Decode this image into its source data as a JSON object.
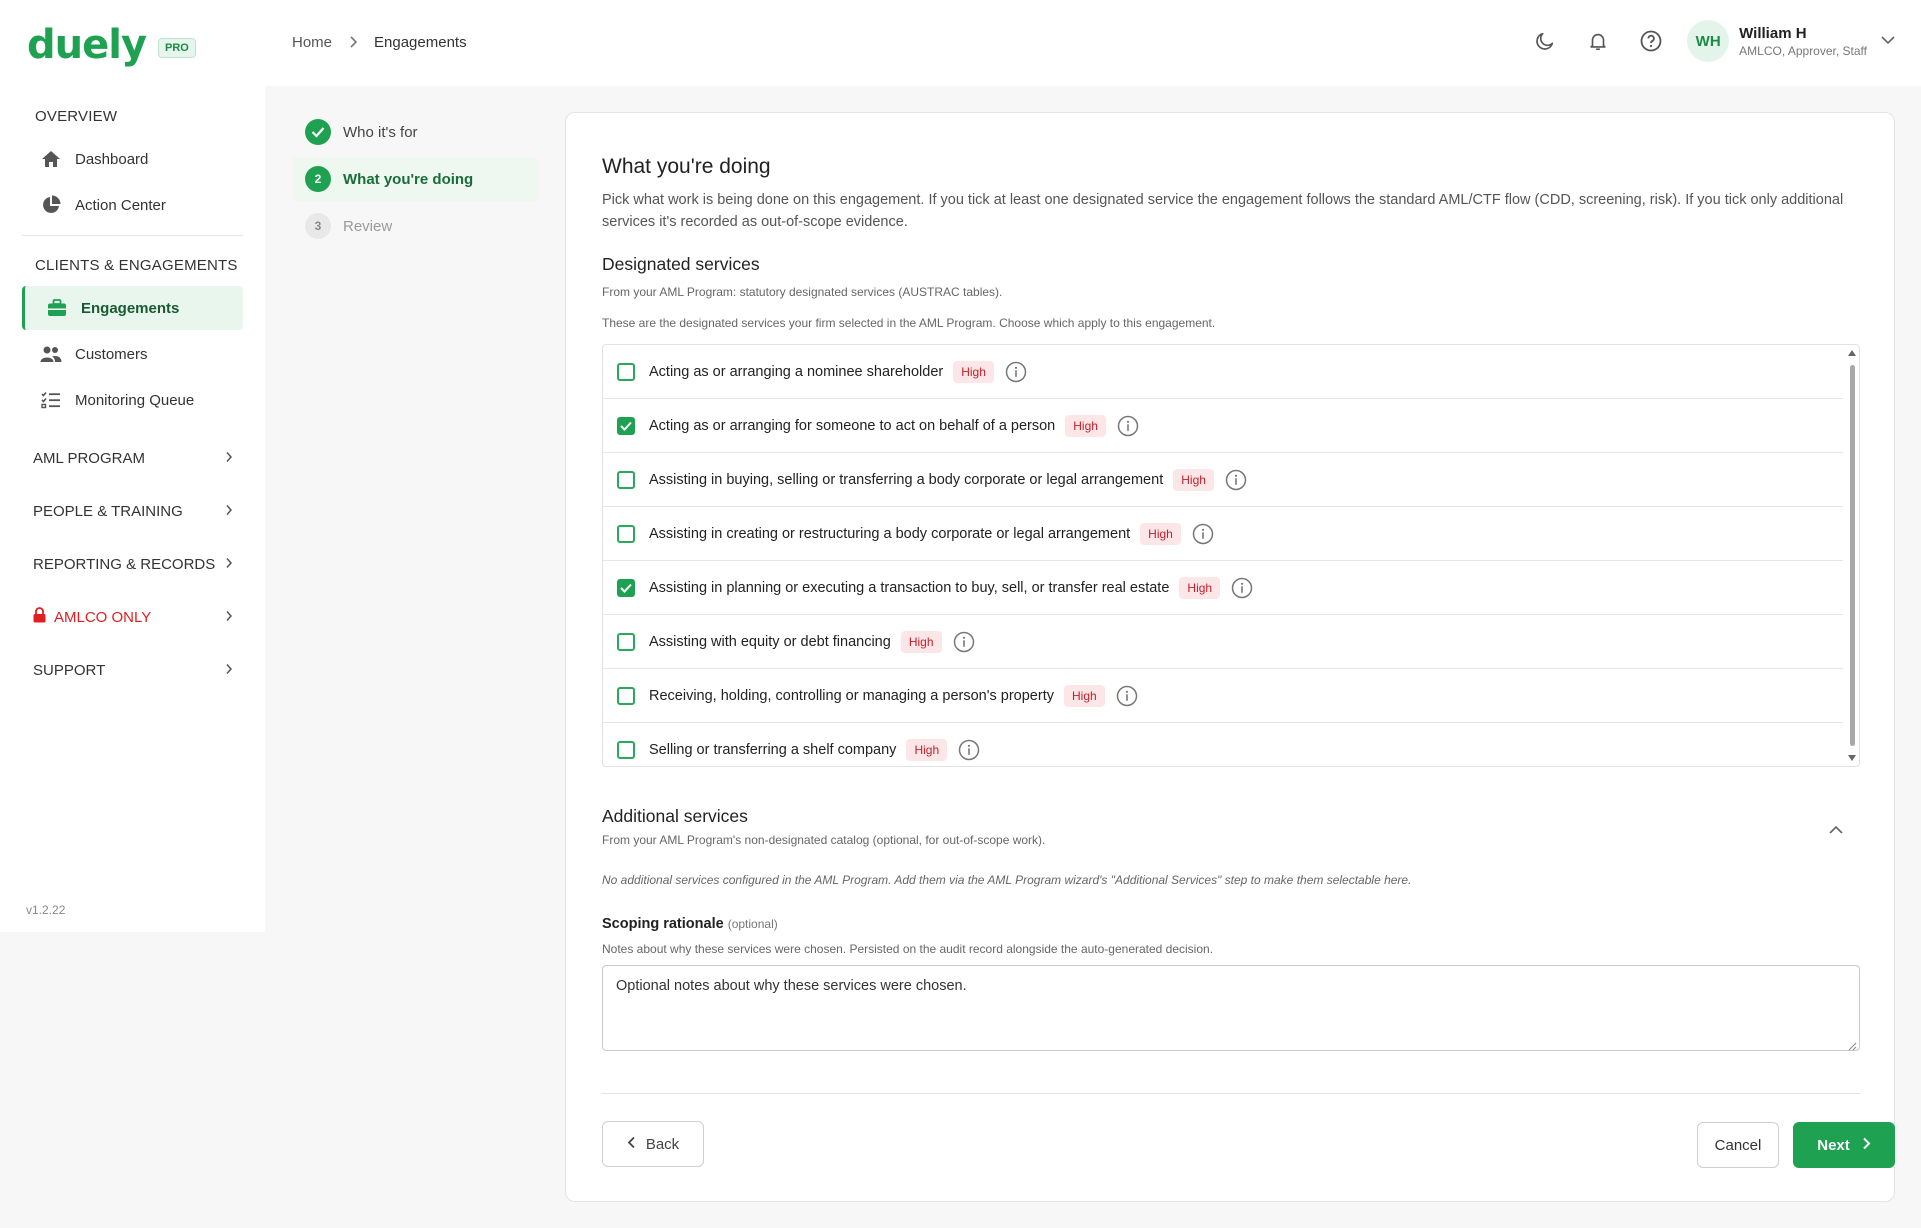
{
  "brand": {
    "name": "duely",
    "tier": "PRO"
  },
  "breadcrumb": {
    "home": "Home",
    "current": "Engagements"
  },
  "topbar": {
    "icons": [
      "moon-icon",
      "bell-icon",
      "help-icon"
    ],
    "user": {
      "initials": "WH",
      "name": "William H",
      "role": "AMLCO, Approver, Staff"
    }
  },
  "sidebar": {
    "overview_label": "OVERVIEW",
    "overview_items": [
      {
        "label": "Dashboard",
        "icon": "home-icon"
      },
      {
        "label": "Action Center",
        "icon": "pie-chart-icon"
      }
    ],
    "clients_label": "CLIENTS & ENGAGEMENTS",
    "clients_items": [
      {
        "label": "Engagements",
        "icon": "briefcase-icon",
        "active": true
      },
      {
        "label": "Customers",
        "icon": "people-icon"
      },
      {
        "label": "Monitoring Queue",
        "icon": "checklist-icon"
      }
    ],
    "groups": [
      {
        "label": "AML PROGRAM"
      },
      {
        "label": "PEOPLE & TRAINING"
      },
      {
        "label": "REPORTING & RECORDS"
      },
      {
        "label": "AMLCO ONLY",
        "color": "#e02020"
      },
      {
        "label": "SUPPORT"
      }
    ],
    "version": "v1.2.22"
  },
  "stepper": {
    "steps": [
      {
        "label": "Who it's for",
        "state": "done"
      },
      {
        "number": "2",
        "label": "What you're doing",
        "state": "active"
      },
      {
        "number": "3",
        "label": "Review",
        "state": "todo"
      }
    ]
  },
  "main": {
    "title": "What you're doing",
    "description": "Pick what work is being done on this engagement. If you tick at least one designated service the engagement follows the standard AML/CTF flow (CDD, screening, risk). If you tick only additional services it's recorded as out-of-scope evidence.",
    "designated": {
      "heading": "Designated services",
      "source_note": "From your AML Program: statutory designated services (AUSTRAC tables).",
      "help_note": "These are the designated services your firm selected in the AML Program. Choose which apply to this engagement.",
      "items": [
        {
          "label": "Acting as or arranging a nominee shareholder",
          "risk": "High",
          "checked": false
        },
        {
          "label": "Acting as or arranging for someone to act on behalf of a person",
          "risk": "High",
          "checked": true
        },
        {
          "label": "Assisting in buying, selling or transferring a body corporate or legal arrangement",
          "risk": "High",
          "checked": false
        },
        {
          "label": "Assisting in creating or restructuring a body corporate or legal arrangement",
          "risk": "High",
          "checked": false
        },
        {
          "label": "Assisting in planning or executing a transaction to buy, sell, or transfer real estate",
          "risk": "High",
          "checked": true
        },
        {
          "label": "Assisting with equity or debt financing",
          "risk": "High",
          "checked": false
        },
        {
          "label": "Receiving, holding, controlling or managing a person's property",
          "risk": "High",
          "checked": false
        },
        {
          "label": "Selling or transferring a shelf company",
          "risk": "High",
          "checked": false
        }
      ]
    },
    "additional": {
      "heading": "Additional services",
      "source_note": "From your AML Program's non-designated catalog (optional, for out-of-scope work).",
      "empty_note": "No additional services configured in the AML Program. Add them via the AML Program wizard's \"Additional Services\" step to make them selectable here."
    },
    "rationale": {
      "label": "Scoping rationale",
      "optional": "(optional)",
      "help": "Notes about why these services were chosen. Persisted on the audit record alongside the auto-generated decision.",
      "placeholder": "Optional notes about why these services were chosen.",
      "value": ""
    },
    "buttons": {
      "back": "Back",
      "cancel": "Cancel",
      "next": "Next"
    }
  },
  "colors": {
    "brand": "#1ea252",
    "risk_high_bg": "#fde6e7",
    "risk_high_text": "#c4202a",
    "alert": "#e02020"
  }
}
